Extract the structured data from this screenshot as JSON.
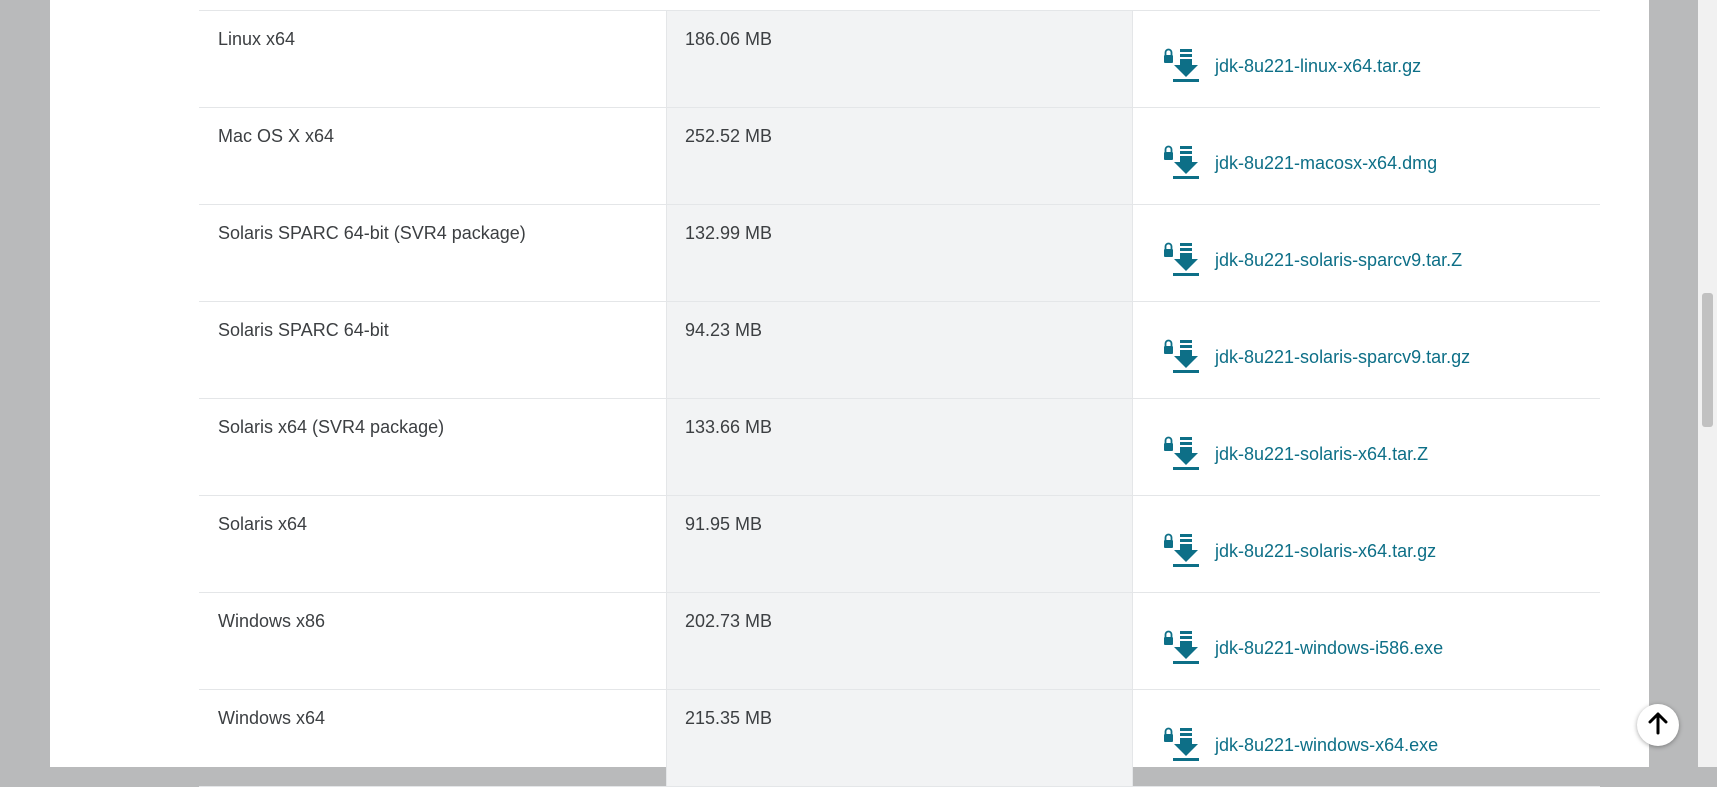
{
  "downloads": [
    {
      "os": "Linux x64",
      "size": "186.06 MB",
      "file": "jdk-8u221-linux-x64.tar.gz"
    },
    {
      "os": "Mac OS X x64",
      "size": "252.52 MB",
      "file": "jdk-8u221-macosx-x64.dmg"
    },
    {
      "os": "Solaris SPARC 64-bit (SVR4 package)",
      "size": "132.99 MB",
      "file": "jdk-8u221-solaris-sparcv9.tar.Z"
    },
    {
      "os": "Solaris SPARC 64-bit",
      "size": "94.23 MB",
      "file": "jdk-8u221-solaris-sparcv9.tar.gz"
    },
    {
      "os": "Solaris x64 (SVR4 package)",
      "size": "133.66 MB",
      "file": "jdk-8u221-solaris-x64.tar.Z"
    },
    {
      "os": "Solaris x64",
      "size": "91.95 MB",
      "file": "jdk-8u221-solaris-x64.tar.gz"
    },
    {
      "os": "Windows x86",
      "size": "202.73 MB",
      "file": "jdk-8u221-windows-i586.exe"
    },
    {
      "os": "Windows x64",
      "size": "215.35 MB",
      "file": "jdk-8u221-windows-x64.exe"
    }
  ],
  "icons": {
    "download": "lock-download-icon",
    "back_to_top": "arrow-up-icon"
  },
  "colors": {
    "link": "#0d6f87",
    "text": "#3c3f42"
  }
}
